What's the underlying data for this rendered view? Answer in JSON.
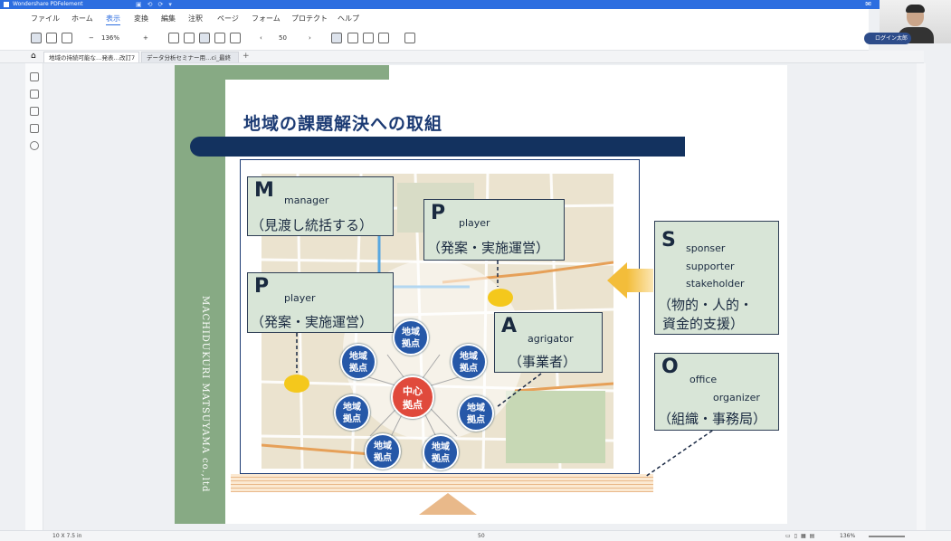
{
  "app": {
    "title": "Wondershare PDFelement"
  },
  "menu": [
    "ファイル",
    "ホーム",
    "表示",
    "変換",
    "編集",
    "注釈",
    "ページ",
    "フォーム",
    "プロテクト",
    "ヘルプ"
  ],
  "menu_active": "表示",
  "toolbar": {
    "zoom": "136%",
    "page": "50"
  },
  "tabs": [
    {
      "label": "地域の持続可能な…発表…改訂7"
    },
    {
      "label": "データ分析セミナー用…ci_最終"
    }
  ],
  "user_button": "ログイン太郎",
  "status": {
    "page_size": "10 X 7.5 in",
    "page": "50",
    "zoom": "136%"
  },
  "slide": {
    "title": "地域の課題解決への取組",
    "side_text": "MACHIDUKURI MATSUYAMA co.,ltd",
    "boxes": {
      "m": {
        "letter": "M",
        "role": "manager",
        "jp": "（見渡し統括する）"
      },
      "p1": {
        "letter": "P",
        "role": "player",
        "jp": "（発案・実施運営）"
      },
      "p2": {
        "letter": "P",
        "role": "player",
        "jp": "（発案・実施運営）"
      },
      "a": {
        "letter": "A",
        "role": "agrigator",
        "jp": "（事業者）"
      },
      "s": {
        "letter": "S",
        "role1": "sponser",
        "role2": "supporter",
        "role3": "stakeholder",
        "jp1": "（物的・人的・",
        "jp2": "資金的支援）"
      },
      "o": {
        "letter": "O",
        "role1": "office",
        "role2": "organizer",
        "jp": "（組織・事務局）"
      }
    },
    "center_node": {
      "l1": "中心",
      "l2": "拠点"
    },
    "nodes": {
      "l1": "地域",
      "l2": "拠点"
    }
  }
}
